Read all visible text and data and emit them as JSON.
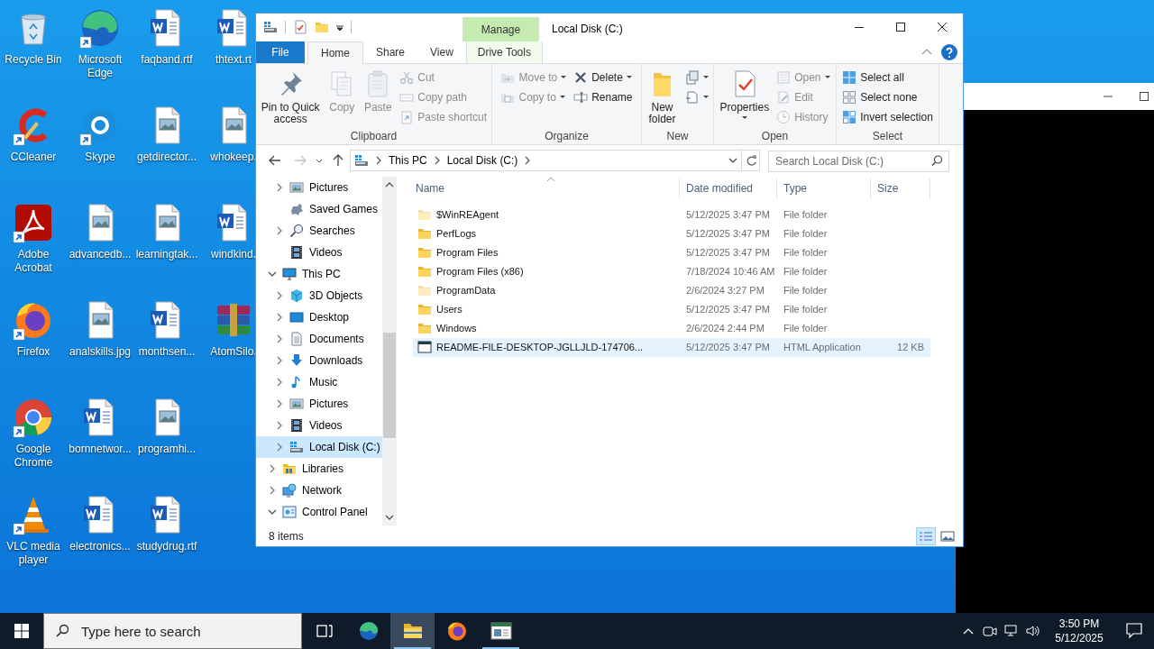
{
  "desktop_icons": [
    {
      "label": "Recycle Bin",
      "shortcut": false
    },
    {
      "label": "CCleaner",
      "shortcut": true
    },
    {
      "label": "Adobe Acrobat",
      "shortcut": true
    },
    {
      "label": "Firefox",
      "shortcut": true
    },
    {
      "label": "Google Chrome",
      "shortcut": true
    },
    {
      "label": "VLC media player",
      "shortcut": true
    },
    {
      "label": "Microsoft Edge",
      "shortcut": true
    },
    {
      "label": "Skype",
      "shortcut": true
    },
    {
      "label": "advancedb...",
      "shortcut": false
    },
    {
      "label": "analskills.jpg",
      "shortcut": false
    },
    {
      "label": "bornnetwor...",
      "shortcut": false
    },
    {
      "label": "electronics...",
      "shortcut": false
    },
    {
      "label": "faqband.rtf",
      "shortcut": false
    },
    {
      "label": "getdirector...",
      "shortcut": false
    },
    {
      "label": "learningtak...",
      "shortcut": false
    },
    {
      "label": "monthsen...",
      "shortcut": false
    },
    {
      "label": "programhi...",
      "shortcut": false
    },
    {
      "label": "studydrug.rtf",
      "shortcut": false
    },
    {
      "label": "thtext.rt",
      "shortcut": false
    },
    {
      "label": "whokeep.",
      "shortcut": false
    },
    {
      "label": "windkind.",
      "shortcut": false
    },
    {
      "label": "AtomSilo.",
      "shortcut": false
    }
  ],
  "explorer": {
    "title": "Local Disk (C:)",
    "context_tab": "Manage",
    "ribbon_tabs": [
      {
        "label": "File",
        "kind": "file",
        "selected": false
      },
      {
        "label": "Home",
        "kind": "tab",
        "selected": true
      },
      {
        "label": "Share",
        "kind": "tab",
        "selected": false
      },
      {
        "label": "View",
        "kind": "tab",
        "selected": false
      },
      {
        "label": "Drive Tools",
        "kind": "context",
        "selected": false
      }
    ],
    "ribbon_groups": [
      {
        "label": "Clipboard",
        "columns": [
          [
            {
              "label": "Pin to Quick access",
              "kind": "large",
              "disabled": false,
              "dropdown": false
            }
          ],
          [
            {
              "label": "Copy",
              "kind": "large",
              "disabled": true,
              "dropdown": false
            }
          ],
          [
            {
              "label": "Paste",
              "kind": "large",
              "disabled": true,
              "dropdown": false
            }
          ],
          [
            {
              "label": "Cut",
              "kind": "small",
              "disabled": true,
              "dropdown": false
            },
            {
              "label": "Copy path",
              "kind": "small",
              "disabled": true,
              "dropdown": false
            },
            {
              "label": "Paste shortcut",
              "kind": "small",
              "disabled": true,
              "dropdown": false
            }
          ]
        ]
      },
      {
        "label": "Organize",
        "columns": [
          [
            {
              "label": "Move to",
              "kind": "small",
              "disabled": true,
              "dropdown": true
            },
            {
              "label": "Copy to",
              "kind": "small",
              "disabled": true,
              "dropdown": true
            }
          ],
          [
            {
              "label": "Delete",
              "kind": "small",
              "disabled": false,
              "dropdown": true
            },
            {
              "label": "Rename",
              "kind": "small",
              "disabled": false,
              "dropdown": false
            }
          ]
        ]
      },
      {
        "label": "New",
        "columns": [
          [
            {
              "label": "New folder",
              "kind": "large",
              "disabled": false,
              "dropdown": false
            }
          ],
          [
            {
              "kind": "small",
              "disabled": false,
              "dropdown": true
            },
            {
              "kind": "small",
              "disabled": false,
              "dropdown": true
            }
          ]
        ]
      },
      {
        "label": "Open",
        "columns": [
          [
            {
              "label": "Properties",
              "kind": "large",
              "disabled": false,
              "dropdown": true
            }
          ],
          [
            {
              "label": "Open",
              "kind": "small",
              "disabled": true,
              "dropdown": true
            },
            {
              "label": "Edit",
              "kind": "small",
              "disabled": true,
              "dropdown": false
            },
            {
              "label": "History",
              "kind": "small",
              "disabled": true,
              "dropdown": false
            }
          ]
        ]
      },
      {
        "label": "Select",
        "columns": [
          [
            {
              "label": "Select all",
              "kind": "small",
              "disabled": false,
              "dropdown": false
            },
            {
              "label": "Select none",
              "kind": "small",
              "disabled": false,
              "dropdown": false
            },
            {
              "label": "Invert selection",
              "kind": "small",
              "disabled": false,
              "dropdown": false
            }
          ]
        ]
      }
    ],
    "address": {
      "crumbs": [
        "This PC",
        "Local Disk (C:)"
      ]
    },
    "search": {
      "placeholder": "Search Local Disk (C:)"
    },
    "nav_pane": {
      "partial_branch": [
        {
          "label": "Pictures",
          "expandable": true,
          "expanded": false,
          "selected": false
        },
        {
          "label": "Saved Games",
          "expandable": false,
          "selected": false
        },
        {
          "label": "Searches",
          "expandable": true,
          "expanded": false,
          "selected": false
        },
        {
          "label": "Videos",
          "expandable": false,
          "selected": false
        }
      ],
      "tree": [
        {
          "label": "This PC",
          "expandable": true,
          "expanded": true,
          "selected": false,
          "children": [
            {
              "label": "3D Objects",
              "expandable": true,
              "expanded": false,
              "selected": false
            },
            {
              "label": "Desktop",
              "expandable": true,
              "expanded": false,
              "selected": false
            },
            {
              "label": "Documents",
              "expandable": true,
              "expanded": false,
              "selected": false
            },
            {
              "label": "Downloads",
              "expandable": true,
              "expanded": false,
              "selected": false
            },
            {
              "label": "Music",
              "expandable": true,
              "expanded": false,
              "selected": false
            },
            {
              "label": "Pictures",
              "expandable": true,
              "expanded": false,
              "selected": false
            },
            {
              "label": "Videos",
              "expandable": true,
              "expanded": false,
              "selected": false
            },
            {
              "label": "Local Disk (C:)",
              "expandable": true,
              "expanded": false,
              "selected": true
            }
          ]
        },
        {
          "label": "Libraries",
          "expandable": true,
          "expanded": false,
          "selected": false
        },
        {
          "label": "Network",
          "expandable": true,
          "expanded": false,
          "selected": false
        },
        {
          "label": "Control Panel",
          "expandable": true,
          "expanded": true,
          "selected": false
        }
      ]
    },
    "file_list": {
      "columns": [
        {
          "label": "Name",
          "sorted": true
        },
        {
          "label": "Date modified",
          "sorted": false
        },
        {
          "label": "Type",
          "sorted": false
        },
        {
          "label": "Size",
          "sorted": false
        }
      ],
      "rows": [
        {
          "name": "$WinREAgent",
          "date": "5/12/2025 3:47 PM",
          "type": "File folder",
          "kind": "folder",
          "hidden": true,
          "selected": false
        },
        {
          "name": "PerfLogs",
          "date": "5/12/2025 3:47 PM",
          "type": "File folder",
          "kind": "folder",
          "hidden": false,
          "selected": false
        },
        {
          "name": "Program Files",
          "date": "5/12/2025 3:47 PM",
          "type": "File folder",
          "kind": "folder",
          "hidden": false,
          "selected": false
        },
        {
          "name": "Program Files (x86)",
          "date": "7/18/2024 10:46 AM",
          "type": "File folder",
          "kind": "folder",
          "hidden": false,
          "selected": false
        },
        {
          "name": "ProgramData",
          "date": "2/6/2024 3:27 PM",
          "type": "File folder",
          "kind": "folder",
          "hidden": true,
          "selected": false
        },
        {
          "name": "Users",
          "date": "5/12/2025 3:47 PM",
          "type": "File folder",
          "kind": "folder",
          "hidden": false,
          "selected": false
        },
        {
          "name": "Windows",
          "date": "2/6/2024 2:44 PM",
          "type": "File folder",
          "kind": "folder",
          "hidden": false,
          "selected": false
        },
        {
          "name": "README-FILE-DESKTOP-JGLLJLD-174706...",
          "date": "5/12/2025 3:47 PM",
          "type": "HTML Application",
          "size": "12 KB",
          "kind": "app",
          "hidden": false,
          "selected": true
        }
      ]
    },
    "status_bar": {
      "item_count": "8 items",
      "views": [
        {
          "selected": true
        },
        {
          "selected": false
        }
      ]
    }
  },
  "taskbar": {
    "search": {
      "placeholder": "Type here to search"
    },
    "apps": [
      {
        "running": false,
        "active": false
      },
      {
        "running": true,
        "active": true
      },
      {
        "running": false,
        "active": false
      },
      {
        "running": true,
        "active": false
      }
    ],
    "clock": {
      "time": "3:50 PM",
      "date": "5/12/2025"
    }
  }
}
